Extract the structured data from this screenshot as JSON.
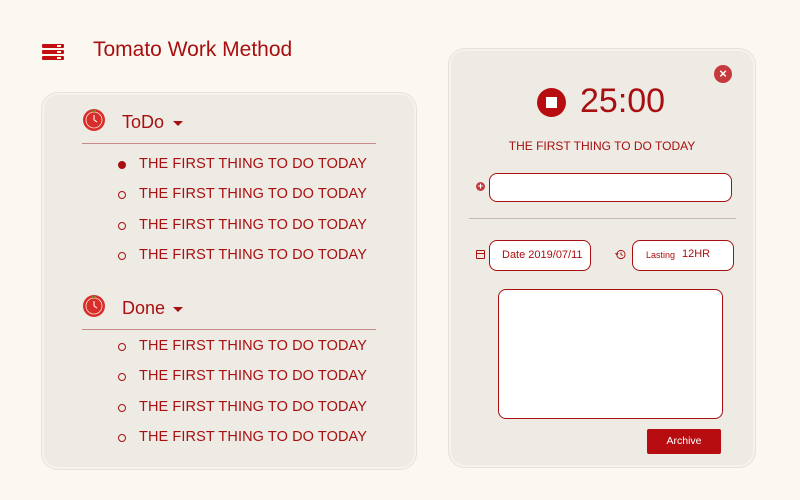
{
  "app": {
    "title": "Tomato Work Method"
  },
  "todo": {
    "title": "ToDo",
    "items": [
      {
        "label": "THE FIRST THING TO DO TODAY",
        "active": true
      },
      {
        "label": "THE FIRST THING TO DO TODAY",
        "active": false
      },
      {
        "label": "THE FIRST THING TO DO TODAY",
        "active": false
      },
      {
        "label": "THE FIRST THING TO DO TODAY",
        "active": false
      }
    ]
  },
  "done": {
    "title": "Done",
    "items": [
      {
        "label": "THE FIRST THING TO DO TODAY"
      },
      {
        "label": "THE FIRST THING TO DO TODAY"
      },
      {
        "label": "THE FIRST THING TO DO TODAY"
      },
      {
        "label": "THE FIRST THING TO DO TODAY"
      }
    ]
  },
  "detail": {
    "timer": "25:00",
    "current_task": "THE FIRST THING TO DO TODAY",
    "new_item_value": "",
    "date_label": "Date 2019/07/11",
    "lasting_label": "Lasting",
    "lasting_value": "12HR",
    "notes_value": "",
    "archive_label": "Archive"
  },
  "icons": {
    "menu": "menu-icon",
    "tomato": "tomato-clock-icon",
    "close": "close-icon",
    "stop": "stop-icon",
    "add": "plus-circle-icon",
    "calendar": "calendar-icon",
    "history": "history-icon"
  },
  "colors": {
    "accent": "#a80f10",
    "accent_bright": "#c40f12",
    "background": "#fbf8f1",
    "panel": "#eeebe5"
  }
}
